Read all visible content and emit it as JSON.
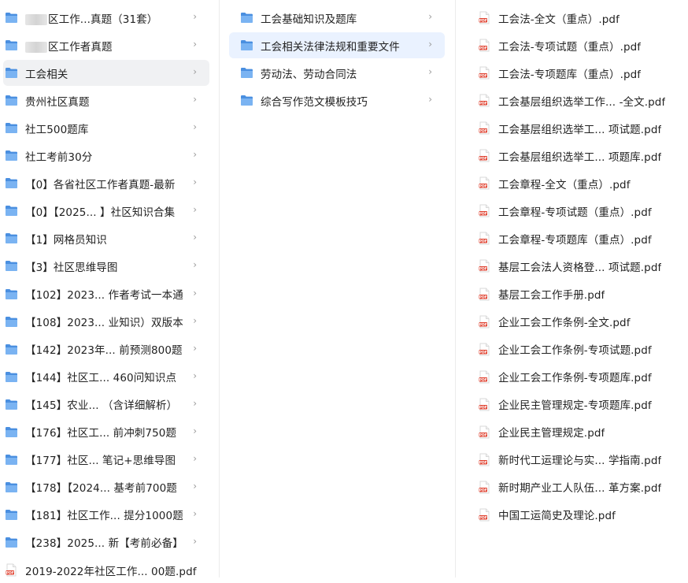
{
  "columns": [
    {
      "items": [
        {
          "type": "folder",
          "label": "区工作...真题（31套）",
          "blurred_prefix": true
        },
        {
          "type": "folder",
          "label": "区工作者真题",
          "blurred_prefix": true
        },
        {
          "type": "folder",
          "label": "工会相关",
          "state": "selected"
        },
        {
          "type": "folder",
          "label": "贵州社区真题"
        },
        {
          "type": "folder",
          "label": "社工500题库"
        },
        {
          "type": "folder",
          "label": "社工考前30分"
        },
        {
          "type": "folder",
          "label": "【0】各省社区工作者真题-最新"
        },
        {
          "type": "folder",
          "label": "【0】【2025... 】社区知识合集"
        },
        {
          "type": "folder",
          "label": "【1】网格员知识"
        },
        {
          "type": "folder",
          "label": "【3】社区思维导图"
        },
        {
          "type": "folder",
          "label": "【102】2023... 作者考试一本通"
        },
        {
          "type": "folder",
          "label": "【108】2023... 业知识）双版本"
        },
        {
          "type": "folder",
          "label": "【142】2023年... 前预测800题"
        },
        {
          "type": "folder",
          "label": "【144】社区工...   460问知识点"
        },
        {
          "type": "folder",
          "label": "【145】农业...   （含详细解析）"
        },
        {
          "type": "folder",
          "label": "【176】社区工...   前冲刺750题"
        },
        {
          "type": "folder",
          "label": "【177】社区...   笔记+思维导图"
        },
        {
          "type": "folder",
          "label": "【178】【2024...   基考前700题"
        },
        {
          "type": "folder",
          "label": "【181】社区工作... 提分1000题"
        },
        {
          "type": "folder",
          "label": "【238】2025... 新【考前必备】"
        },
        {
          "type": "pdf",
          "label": "2019-2022年社区工作... 00题.pdf"
        }
      ]
    },
    {
      "items": [
        {
          "type": "folder",
          "label": "工会基础知识及题库"
        },
        {
          "type": "folder",
          "label": "工会相关法律法规和重要文件",
          "state": "active"
        },
        {
          "type": "folder",
          "label": "劳动法、劳动合同法"
        },
        {
          "type": "folder",
          "label": "综合写作范文模板技巧"
        }
      ]
    },
    {
      "items": [
        {
          "type": "pdf",
          "label": "工会法-全文（重点）.pdf"
        },
        {
          "type": "pdf",
          "label": "工会法-专项试题（重点）.pdf"
        },
        {
          "type": "pdf",
          "label": "工会法-专项题库（重点）.pdf"
        },
        {
          "type": "pdf",
          "label": "工会基层组织选举工作... -全文.pdf"
        },
        {
          "type": "pdf",
          "label": "工会基层组织选举工...   项试题.pdf"
        },
        {
          "type": "pdf",
          "label": "工会基层组织选举工...   项题库.pdf"
        },
        {
          "type": "pdf",
          "label": "工会章程-全文（重点）.pdf"
        },
        {
          "type": "pdf",
          "label": "工会章程-专项试题（重点）.pdf"
        },
        {
          "type": "pdf",
          "label": "工会章程-专项题库（重点）.pdf"
        },
        {
          "type": "pdf",
          "label": "基层工会法人资格登...   项试题.pdf"
        },
        {
          "type": "pdf",
          "label": "基层工会工作手册.pdf"
        },
        {
          "type": "pdf",
          "label": "企业工会工作条例-全文.pdf"
        },
        {
          "type": "pdf",
          "label": "企业工会工作条例-专项试题.pdf"
        },
        {
          "type": "pdf",
          "label": "企业工会工作条例-专项题库.pdf"
        },
        {
          "type": "pdf",
          "label": "企业民主管理规定-专项题库.pdf"
        },
        {
          "type": "pdf",
          "label": "企业民主管理规定.pdf"
        },
        {
          "type": "pdf",
          "label": "新时代工运理论与实...   学指南.pdf"
        },
        {
          "type": "pdf",
          "label": "新时期产业工人队伍...   革方案.pdf"
        },
        {
          "type": "pdf",
          "label": "中国工运简史及理论.pdf"
        }
      ]
    }
  ],
  "icons": {
    "folder": "folder-icon",
    "pdf": "pdf-file-icon",
    "chevron": "chevron-right-icon",
    "pdf_badge_text": "PDF"
  },
  "colors": {
    "folder_blue": "#4a8fe0",
    "folder_blue_light": "#7ab3f2",
    "pdf_red": "#e0412f",
    "selected_bg": "#f0f1f3",
    "active_bg": "#eaf2ff"
  },
  "chevron_glyph": "›"
}
